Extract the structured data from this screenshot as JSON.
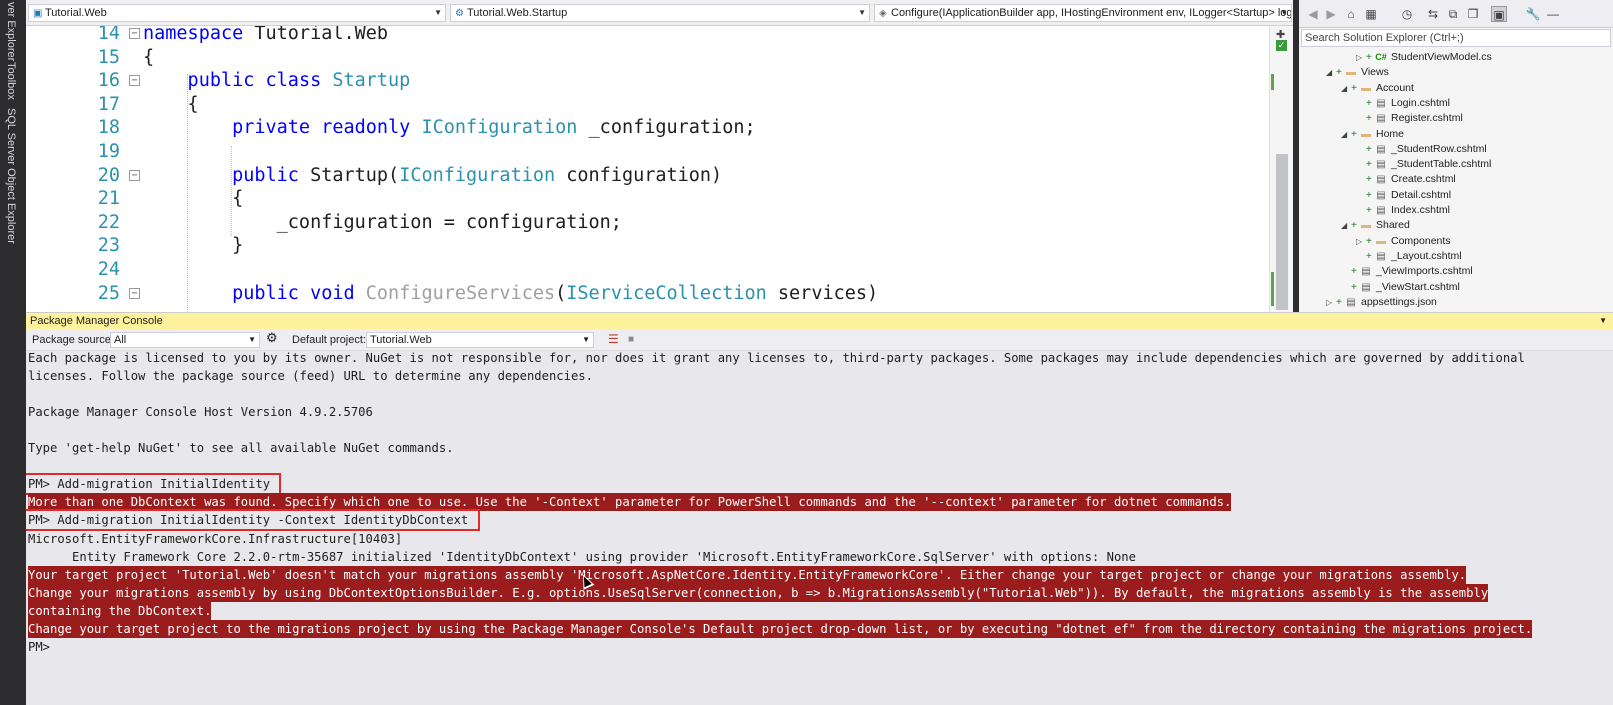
{
  "left_strip": {
    "tabs": [
      "ver Explorer",
      "Toolbox",
      "SQL Server Object Explorer"
    ]
  },
  "editor": {
    "nav": {
      "project": "Tutorial.Web",
      "class": "Tutorial.Web.Startup",
      "member": "Configure(IApplicationBuilder app, IHostingEnvironment env, ILogger<Startup> logger)"
    },
    "lines": [
      {
        "num": "14",
        "tokens": [
          {
            "t": "namespace ",
            "c": "kw"
          },
          {
            "t": "Tutorial.Web",
            "c": ""
          }
        ],
        "fold": "⊟"
      },
      {
        "num": "15",
        "tokens": [
          {
            "t": "{",
            "c": ""
          }
        ],
        "fold": ""
      },
      {
        "num": "16",
        "tokens": [
          {
            "t": "    public ",
            "c": "kw"
          },
          {
            "t": "class ",
            "c": "kw"
          },
          {
            "t": "Startup",
            "c": "ty"
          }
        ],
        "fold": "⊟"
      },
      {
        "num": "17",
        "tokens": [
          {
            "t": "    {",
            "c": ""
          }
        ],
        "fold": ""
      },
      {
        "num": "18",
        "tokens": [
          {
            "t": "        private ",
            "c": "kw"
          },
          {
            "t": "readonly ",
            "c": "kw"
          },
          {
            "t": "IConfiguration",
            "c": "ty"
          },
          {
            "t": " _configuration;",
            "c": ""
          }
        ],
        "fold": ""
      },
      {
        "num": "19",
        "tokens": [
          {
            "t": "",
            "c": ""
          }
        ],
        "fold": ""
      },
      {
        "num": "20",
        "tokens": [
          {
            "t": "        public ",
            "c": "kw"
          },
          {
            "t": "Startup(",
            "c": ""
          },
          {
            "t": "IConfiguration",
            "c": "ty"
          },
          {
            "t": " configuration)",
            "c": ""
          }
        ],
        "fold": "⊟"
      },
      {
        "num": "21",
        "tokens": [
          {
            "t": "        {",
            "c": ""
          }
        ],
        "fold": ""
      },
      {
        "num": "22",
        "tokens": [
          {
            "t": "            _configuration = configuration;",
            "c": ""
          }
        ],
        "fold": ""
      },
      {
        "num": "23",
        "tokens": [
          {
            "t": "        }",
            "c": ""
          }
        ],
        "fold": ""
      },
      {
        "num": "24",
        "tokens": [
          {
            "t": "",
            "c": ""
          }
        ],
        "fold": ""
      },
      {
        "num": "25",
        "tokens": [
          {
            "t": "        public ",
            "c": "kw"
          },
          {
            "t": "void ",
            "c": "kw"
          },
          {
            "t": "ConfigureServices",
            "c": "gr"
          },
          {
            "t": "(",
            "c": ""
          },
          {
            "t": "IServiceCollection",
            "c": "ty"
          },
          {
            "t": " services)",
            "c": ""
          }
        ],
        "fold": "⊟"
      }
    ]
  },
  "solution_explorer": {
    "search_placeholder": "Search Solution Explorer (Ctrl+;)",
    "nodes": [
      {
        "label": "StudentViewModel.cs",
        "depth": 3,
        "expander": "▷",
        "icon": "C#",
        "kind": "cs"
      },
      {
        "label": "Views",
        "depth": 1,
        "expander": "◢",
        "icon": "▬",
        "kind": "folder"
      },
      {
        "label": "Account",
        "depth": 2,
        "expander": "◢",
        "icon": "▬",
        "kind": "folder"
      },
      {
        "label": "Login.cshtml",
        "depth": 3,
        "expander": "",
        "icon": "▤",
        "kind": "file"
      },
      {
        "label": "Register.cshtml",
        "depth": 3,
        "expander": "",
        "icon": "▤",
        "kind": "file"
      },
      {
        "label": "Home",
        "depth": 2,
        "expander": "◢",
        "icon": "▬",
        "kind": "folder"
      },
      {
        "label": "_StudentRow.cshtml",
        "depth": 3,
        "expander": "",
        "icon": "▤",
        "kind": "file"
      },
      {
        "label": "_StudentTable.cshtml",
        "depth": 3,
        "expander": "",
        "icon": "▤",
        "kind": "file"
      },
      {
        "label": "Create.cshtml",
        "depth": 3,
        "expander": "",
        "icon": "▤",
        "kind": "file"
      },
      {
        "label": "Detail.cshtml",
        "depth": 3,
        "expander": "",
        "icon": "▤",
        "kind": "file"
      },
      {
        "label": "Index.cshtml",
        "depth": 3,
        "expander": "",
        "icon": "▤",
        "kind": "file"
      },
      {
        "label": "Shared",
        "depth": 2,
        "expander": "◢",
        "icon": "▬",
        "kind": "folder"
      },
      {
        "label": "Components",
        "depth": 3,
        "expander": "▷",
        "icon": "▬",
        "kind": "folder"
      },
      {
        "label": "_Layout.cshtml",
        "depth": 3,
        "expander": "",
        "icon": "▤",
        "kind": "file"
      },
      {
        "label": "_ViewImports.cshtml",
        "depth": 2,
        "expander": "",
        "icon": "▤",
        "kind": "file"
      },
      {
        "label": "_ViewStart.cshtml",
        "depth": 2,
        "expander": "",
        "icon": "▤",
        "kind": "file"
      },
      {
        "label": "appsettings.json",
        "depth": 1,
        "expander": "▷",
        "icon": "▤",
        "kind": "file"
      }
    ]
  },
  "console": {
    "title": "Package Manager Console",
    "source_label": "Package source:",
    "source_value": "All",
    "project_label": "Default project:",
    "project_value": "Tutorial.Web",
    "lines": [
      {
        "text": "Each package is licensed to you by its owner. NuGet is not responsible for, nor does it grant any licenses to, third-party packages. Some packages may include dependencies which are governed by additional",
        "kind": "normal"
      },
      {
        "text": "licenses. Follow the package source (feed) URL to determine any dependencies.",
        "kind": "normal"
      },
      {
        "text": "",
        "kind": "normal"
      },
      {
        "text": "Package Manager Console Host Version 4.9.2.5706",
        "kind": "normal"
      },
      {
        "text": "",
        "kind": "normal"
      },
      {
        "text": "Type 'get-help NuGet' to see all available NuGet commands.",
        "kind": "normal"
      },
      {
        "text": "",
        "kind": "normal"
      },
      {
        "text": "PM> Add-migration InitialIdentity",
        "kind": "cmd"
      },
      {
        "text": "More than one DbContext was found. Specify which one to use. Use the '-Context' parameter for PowerShell commands and the '--context' parameter for dotnet commands.",
        "kind": "error"
      },
      {
        "text": "PM> Add-migration InitialIdentity -Context IdentityDbContext",
        "kind": "cmd"
      },
      {
        "text": "Microsoft.EntityFrameworkCore.Infrastructure[10403]",
        "kind": "normal"
      },
      {
        "text": "      Entity Framework Core 2.2.0-rtm-35687 initialized 'IdentityDbContext' using provider 'Microsoft.EntityFrameworkCore.SqlServer' with options: None",
        "kind": "normal"
      },
      {
        "text": "Your target project 'Tutorial.Web' doesn't match your migrations assembly 'Microsoft.AspNetCore.Identity.EntityFrameworkCore'. Either change your target project or change your migrations assembly.",
        "kind": "error"
      },
      {
        "text": "Change your migrations assembly by using DbContextOptionsBuilder. E.g. options.UseSqlServer(connection, b => b.MigrationsAssembly(\"Tutorial.Web\")). By default, the migrations assembly is the assembly",
        "kind": "error"
      },
      {
        "text": "containing the DbContext.",
        "kind": "error"
      },
      {
        "text": "Change your target project to the migrations project by using the Package Manager Console's Default project drop-down list, or by executing \"dotnet ef\" from the directory containing the migrations project.",
        "kind": "error"
      },
      {
        "text": "PM>",
        "kind": "normal"
      }
    ]
  }
}
